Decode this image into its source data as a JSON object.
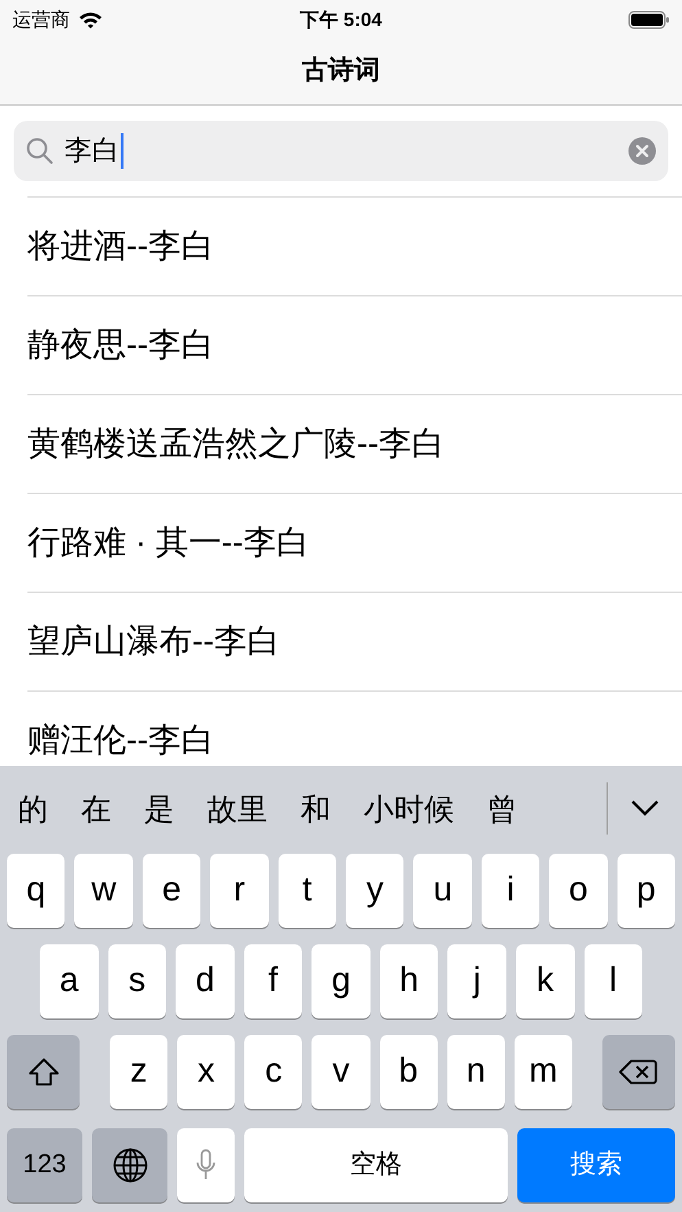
{
  "status_bar": {
    "carrier": "运营商",
    "time": "下午 5:04"
  },
  "nav": {
    "title": "古诗词"
  },
  "search": {
    "value": "李白"
  },
  "results": [
    "将进酒--李白",
    "静夜思--李白",
    "黄鹤楼送孟浩然之广陵--李白",
    "行路难 · 其一--李白",
    "望庐山瀑布--李白",
    "赠汪伦--李白"
  ],
  "keyboard": {
    "candidates": [
      "的",
      "在",
      "是",
      "故里",
      "和",
      "小时候",
      "曾"
    ],
    "rows": [
      [
        "q",
        "w",
        "e",
        "r",
        "t",
        "y",
        "u",
        "i",
        "o",
        "p"
      ],
      [
        "a",
        "s",
        "d",
        "f",
        "g",
        "h",
        "j",
        "k",
        "l"
      ],
      [
        "z",
        "x",
        "c",
        "v",
        "b",
        "n",
        "m"
      ]
    ],
    "numbers_key": "123",
    "space_key": "空格",
    "action_key": "搜索"
  }
}
